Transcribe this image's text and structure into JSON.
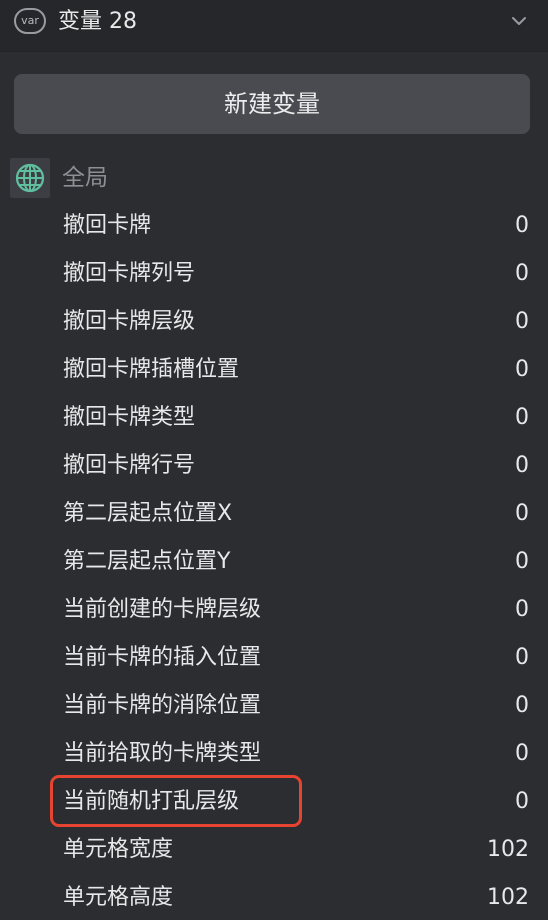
{
  "header": {
    "badge": "var",
    "title": "变量 28",
    "collapse_icon": "chevron-down-icon"
  },
  "new_button": {
    "label": "新建变量"
  },
  "group": {
    "label": "全局",
    "icon": "globe-icon",
    "icon_color": "#5fbf9f"
  },
  "variables": [
    {
      "name": "撤回卡牌",
      "value": "0"
    },
    {
      "name": "撤回卡牌列号",
      "value": "0"
    },
    {
      "name": "撤回卡牌层级",
      "value": "0"
    },
    {
      "name": "撤回卡牌插槽位置",
      "value": "0"
    },
    {
      "name": "撤回卡牌类型",
      "value": "0"
    },
    {
      "name": "撤回卡牌行号",
      "value": "0"
    },
    {
      "name": "第二层起点位置X",
      "value": "0"
    },
    {
      "name": "第二层起点位置Y",
      "value": "0"
    },
    {
      "name": "当前创建的卡牌层级",
      "value": "0"
    },
    {
      "name": "当前卡牌的插入位置",
      "value": "0"
    },
    {
      "name": "当前卡牌的消除位置",
      "value": "0"
    },
    {
      "name": "当前拾取的卡牌类型",
      "value": "0"
    },
    {
      "name": "当前随机打乱层级",
      "value": "0"
    },
    {
      "name": "单元格宽度",
      "value": "102"
    },
    {
      "name": "单元格高度",
      "value": "102"
    }
  ],
  "highlight_color": "#e64431"
}
